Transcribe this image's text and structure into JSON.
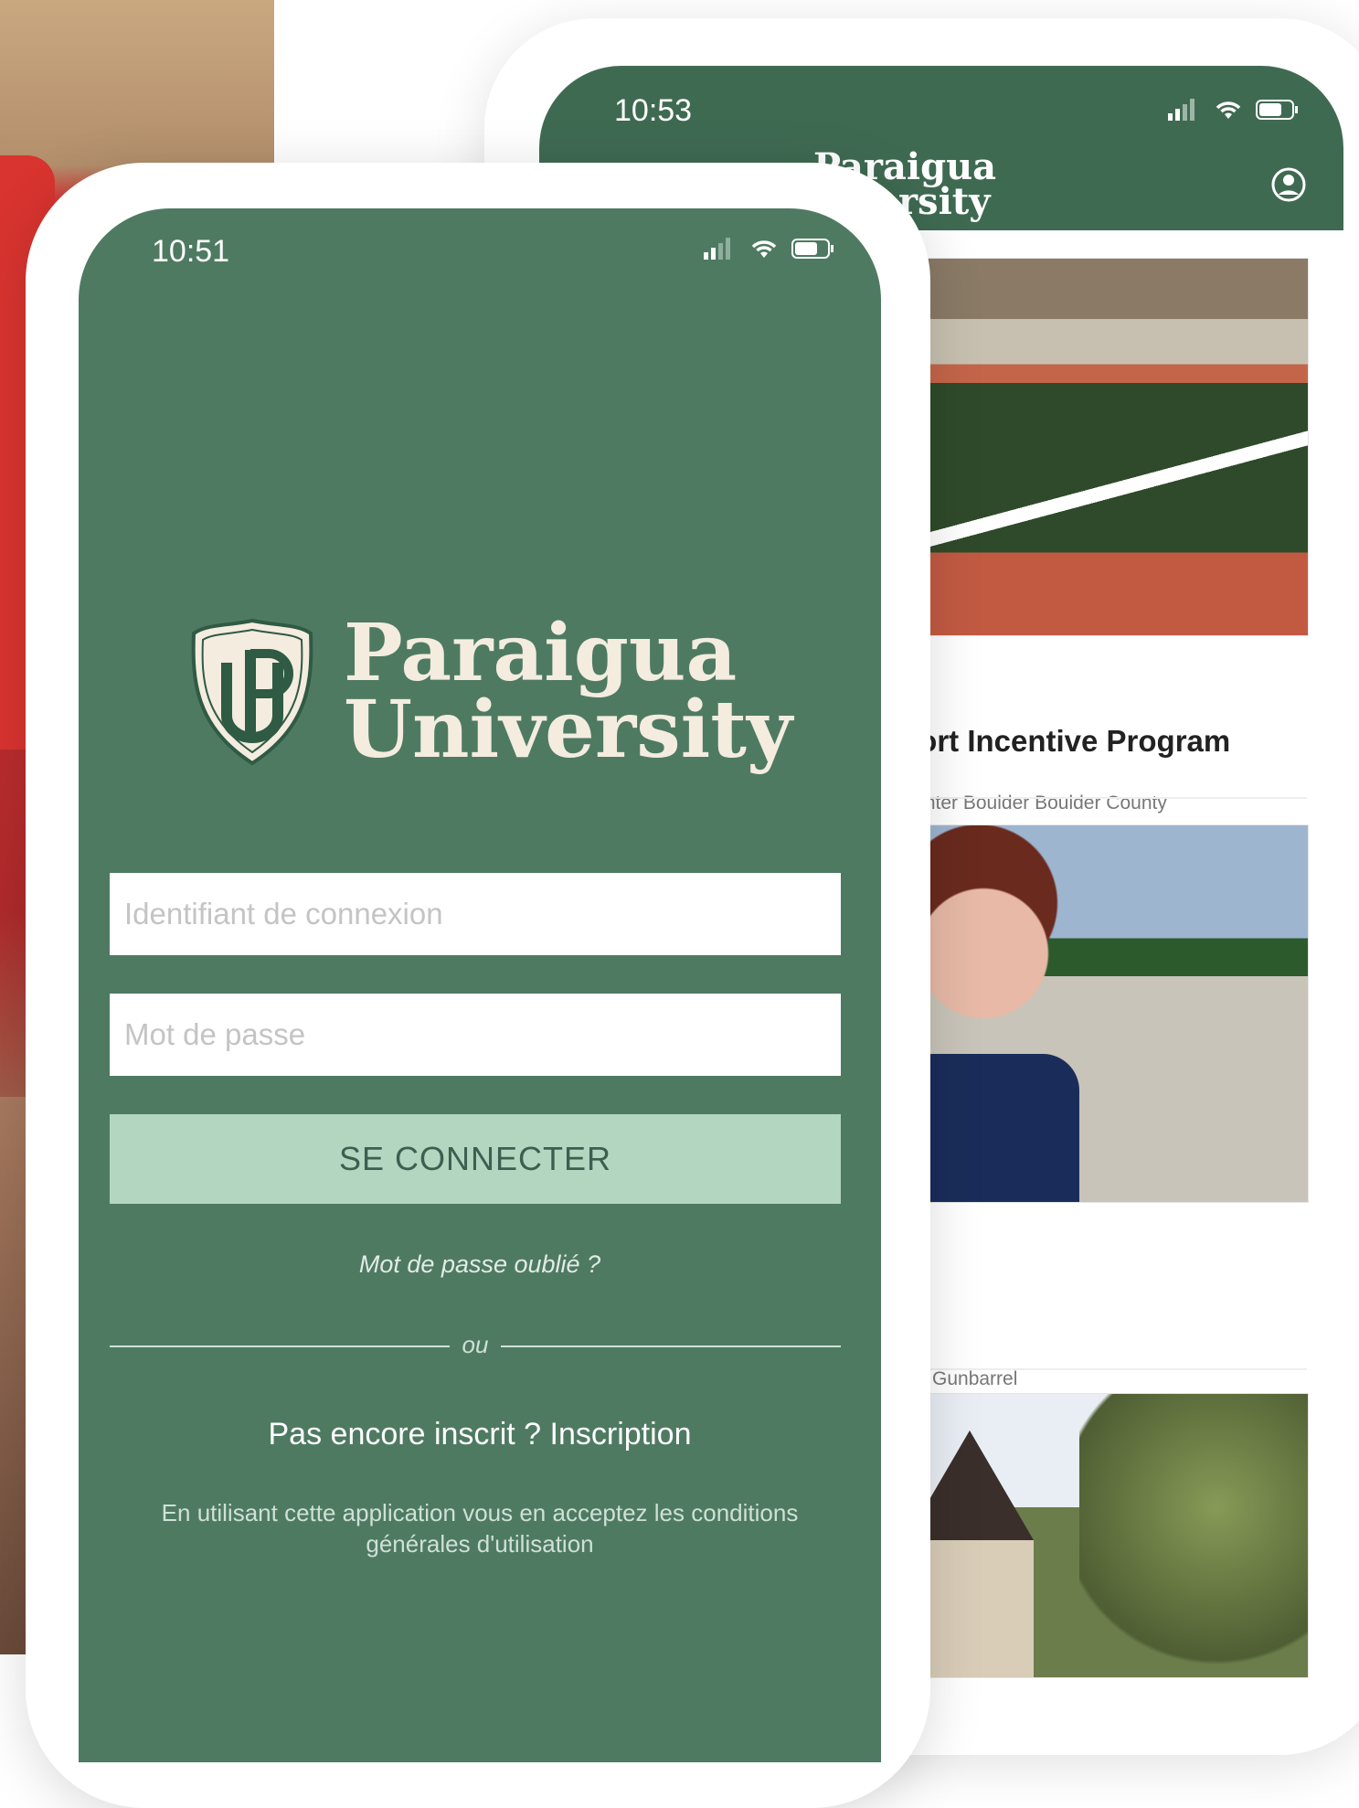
{
  "back_phone": {
    "time": "10:53",
    "brand_line1": "Paraigua",
    "brand_line2": "niversity",
    "cards": [
      {
        "title": "port Incentive Program",
        "subtitle": "Center Boulder Boulder County"
      },
      {
        "title": "",
        "subtitle": "Gunbarrel"
      }
    ]
  },
  "front_phone": {
    "time": "10:51",
    "brand_line1": "Paraigua",
    "brand_line2": "University",
    "login_placeholder": "Identifiant de connexion",
    "password_placeholder": "Mot de passe",
    "connect_label": "SE CONNECTER",
    "forgot_label": "Mot de passe oublié ?",
    "or_label": "ou",
    "signup_label": "Pas encore inscrit ? Inscription",
    "terms_text": "En utilisant cette application vous en acceptez les conditions générales d'utilisation"
  },
  "icons": [
    "signal-icon",
    "wifi-icon",
    "battery-icon",
    "user-account-icon",
    "crest-logo-icon"
  ],
  "colors": {
    "brand_green": "#4e7a62",
    "header_green": "#3f6a52",
    "button_mint": "#b2d6c0",
    "logo_cream": "#f3ecdf"
  }
}
